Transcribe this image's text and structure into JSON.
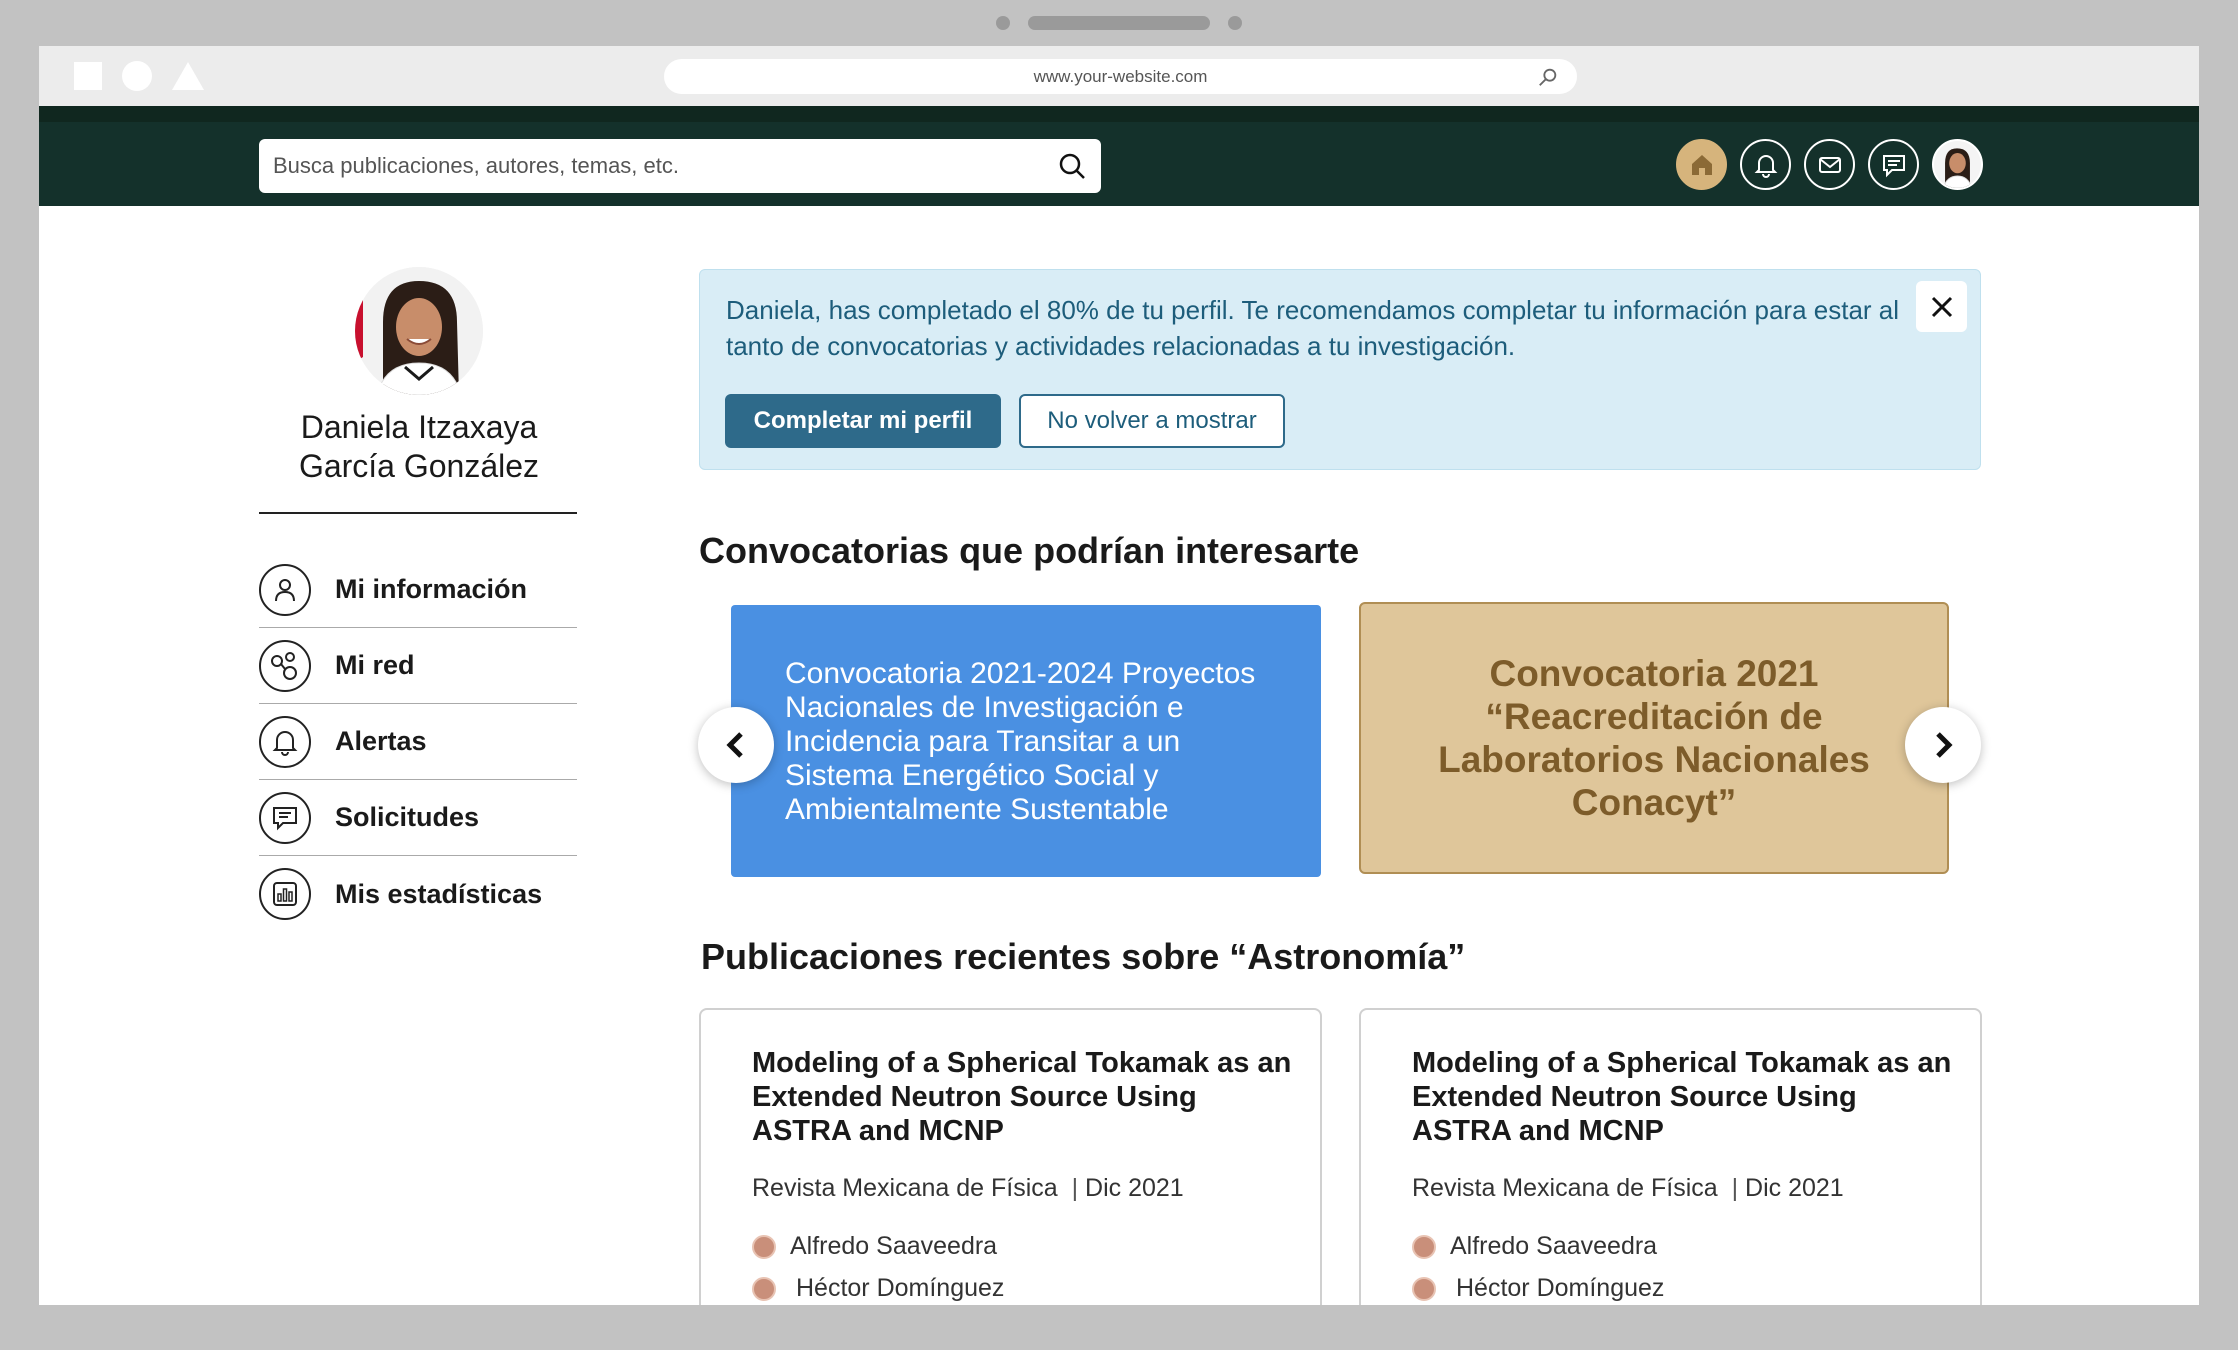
{
  "browser": {
    "url": "www.your-website.com"
  },
  "header": {
    "search_placeholder": "Busca publicaciones, autores, temas, etc.",
    "icons": [
      "home-icon",
      "bell-icon",
      "mail-icon",
      "chat-icon",
      "avatar"
    ]
  },
  "profile": {
    "name_line1": "Daniela Itzaxaya",
    "name_line2": "García González"
  },
  "sidebar": {
    "items": [
      {
        "label": "Mi información",
        "icon": "user-icon"
      },
      {
        "label": "Mi red",
        "icon": "network-icon"
      },
      {
        "label": "Alertas",
        "icon": "bell-icon"
      },
      {
        "label": "Solicitudes",
        "icon": "chat-icon"
      },
      {
        "label": "Mis estadísticas",
        "icon": "bar-chart-icon"
      }
    ]
  },
  "banner": {
    "text": "Daniela, has completado el 80% de tu perfil. Te recomendamos completar tu información para estar al tanto de convocatorias y actividades relacionadas a tu investigación.",
    "primary_label": "Completar mi perfil",
    "secondary_label": "No volver a mostrar",
    "profile_completion_percent": 80
  },
  "convocatorias": {
    "title": "Convocatorias que podrían interesarte",
    "cards": [
      {
        "text": "Convocatoria 2021-2024 Proyectos Nacionales de Investigación e Incidencia para Transitar a un Sistema Energético Social y Ambientalmente Sustentable",
        "color": "#4a90e2"
      },
      {
        "text": "Convocatoria 2021 “Reacreditación de Laboratorios Nacionales Conacyt”",
        "color": "#dfc69a"
      }
    ]
  },
  "publicaciones": {
    "title": "Publicaciones recientes sobre “Astronomía”",
    "items": [
      {
        "title": "Modeling of a Spherical Tokamak as an Extended Neutron Source Using ASTRA and MCNP",
        "journal": "Revista Mexicana de Física",
        "date": "Dic 2021",
        "authors": [
          "Alfredo Saaveedra",
          "Héctor Domínguez"
        ]
      },
      {
        "title": "Modeling of a Spherical Tokamak as an Extended Neutron Source Using ASTRA and MCNP",
        "journal": "Revista Mexicana de Física",
        "date": "Dic 2021",
        "authors": [
          "Alfredo Saaveedra",
          "Héctor Domínguez"
        ]
      }
    ]
  },
  "colors": {
    "header_bg": "#14312b",
    "accent_gold": "#d6b47c",
    "banner_bg": "#d9edf6",
    "primary_button": "#2e6a8a"
  }
}
